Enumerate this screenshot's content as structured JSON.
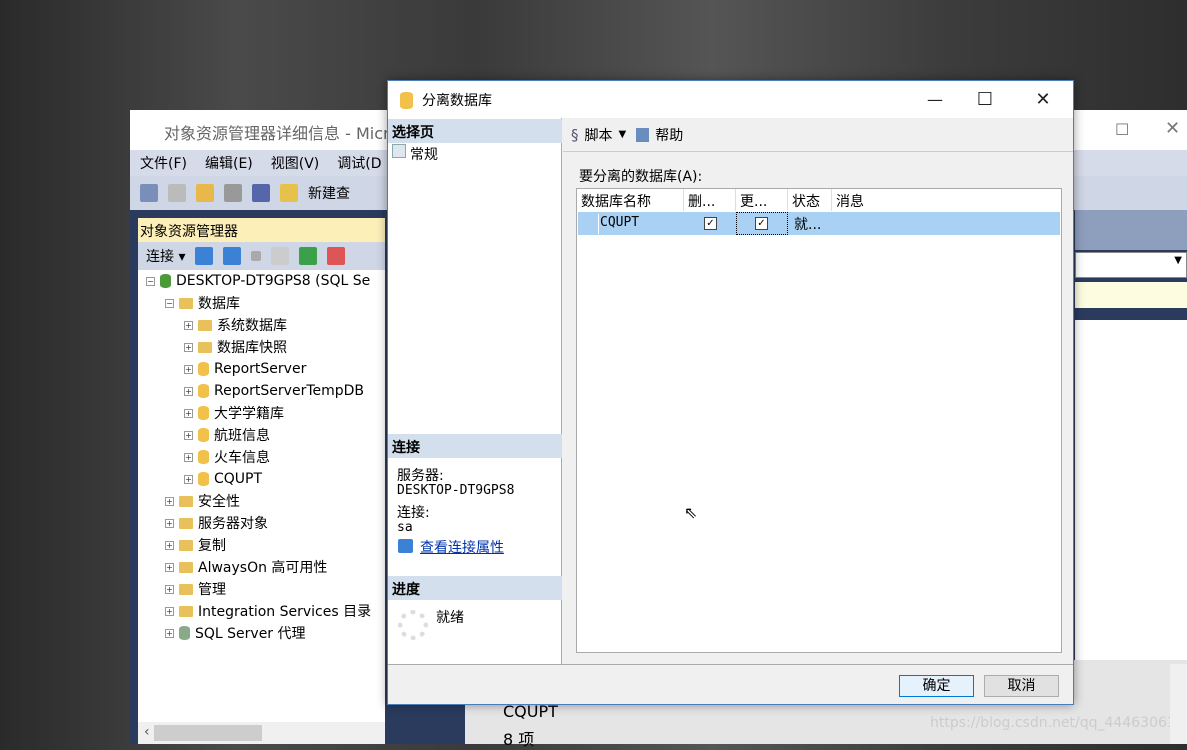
{
  "ssms": {
    "title": "对象资源管理器详细信息 - Micro",
    "menu": [
      "文件(F)",
      "编辑(E)",
      "视图(V)",
      "调试(D"
    ],
    "toolbar_new_query": "新建查",
    "object_explorer": {
      "title": "对象资源管理器",
      "connect_label": "连接",
      "tree": [
        {
          "label": "DESKTOP-DT9GPS8 (SQL Se",
          "level": 0,
          "icon": "server-icon",
          "expander": "-"
        },
        {
          "label": "数据库",
          "level": 1,
          "icon": "folder-icon",
          "expander": "-"
        },
        {
          "label": "系统数据库",
          "level": 2,
          "icon": "folder-icon",
          "expander": "+"
        },
        {
          "label": "数据库快照",
          "level": 2,
          "icon": "folder-icon",
          "expander": "+"
        },
        {
          "label": "ReportServer",
          "level": 2,
          "icon": "database-icon",
          "expander": "+"
        },
        {
          "label": "ReportServerTempDB",
          "level": 2,
          "icon": "database-icon",
          "expander": "+"
        },
        {
          "label": "大学学籍库",
          "level": 2,
          "icon": "database-icon",
          "expander": "+"
        },
        {
          "label": "航班信息",
          "level": 2,
          "icon": "database-icon",
          "expander": "+"
        },
        {
          "label": "火车信息",
          "level": 2,
          "icon": "database-icon",
          "expander": "+"
        },
        {
          "label": "CQUPT",
          "level": 2,
          "icon": "database-icon",
          "expander": "+"
        },
        {
          "label": "安全性",
          "level": 1,
          "icon": "folder-icon",
          "expander": "+"
        },
        {
          "label": "服务器对象",
          "level": 1,
          "icon": "folder-icon",
          "expander": "+"
        },
        {
          "label": "复制",
          "level": 1,
          "icon": "folder-icon",
          "expander": "+"
        },
        {
          "label": "AlwaysOn 高可用性",
          "level": 1,
          "icon": "folder-icon",
          "expander": "+"
        },
        {
          "label": "管理",
          "level": 1,
          "icon": "folder-icon",
          "expander": "+"
        },
        {
          "label": "Integration Services 目录",
          "level": 1,
          "icon": "folder-icon",
          "expander": "+"
        },
        {
          "label": "SQL Server 代理",
          "level": 1,
          "icon": "agent-icon",
          "expander": "+"
        }
      ]
    },
    "details": {
      "name": "CQUPT",
      "count": "8 项"
    },
    "watermark": "https://blog.csdn.net/qq_44463061"
  },
  "dialog": {
    "title": "分离数据库",
    "select_page": {
      "header": "选择页",
      "items": [
        "常规"
      ]
    },
    "connection": {
      "header": "连接",
      "server_label": "服务器:",
      "server": "DESKTOP-DT9GPS8",
      "conn_label": "连接:",
      "conn": "sa",
      "link": "查看连接属性"
    },
    "progress": {
      "header": "进度",
      "status": "就绪"
    },
    "toolbar": {
      "script": "脚本",
      "help": "帮助"
    },
    "grid_label": "要分离的数据库(A):",
    "columns": [
      "数据库名称",
      "删...",
      "更...",
      "状态",
      "消息"
    ],
    "rows": [
      {
        "name": "CQUPT",
        "drop": true,
        "update": true,
        "status": "就...",
        "message": ""
      }
    ],
    "ok": "确定",
    "cancel": "取消"
  }
}
